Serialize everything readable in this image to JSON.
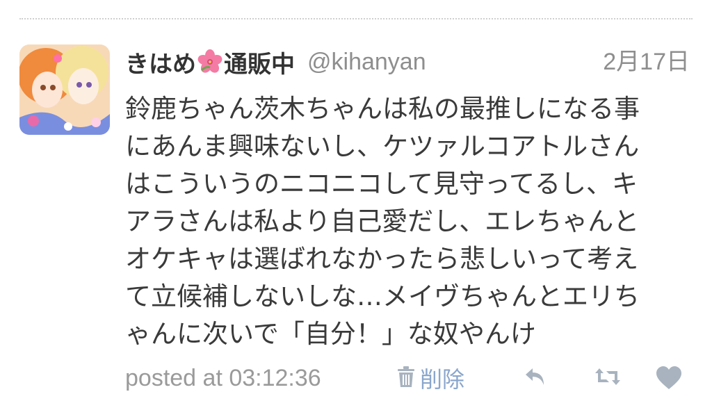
{
  "tweet": {
    "display_name_pre": "きはめ",
    "display_name_post": "通販中",
    "handle": "@kihanyan",
    "date": "2月17日",
    "body_lines": [
      "鈴鹿ちゃん茨木ちゃんは私の最推しになる事",
      "にあんま興味ないし、ケツァルコアトルさん",
      "はこういうのニコニコして見守ってるし、キ",
      "アラさんは私より自己愛だし、エレちゃんと",
      "オケキャは選ばれなかったら悲しいって考え",
      "て立候補しないしな…メイヴちゃんとエリち",
      "ゃんに次いで「自分！」な奴やんけ"
    ],
    "posted_at": "posted at 03:12:36",
    "delete_label": "削除"
  },
  "icons": {
    "avatar": "avatar-illustration",
    "flower": "hibiscus-emoji",
    "trash": "trash-icon",
    "reply": "reply-icon",
    "retweet": "retweet-icon",
    "favorite": "heart-icon"
  },
  "colors": {
    "text": "#3a3a3a",
    "muted": "#8e8e8e",
    "link": "#8aa6cc",
    "icon": "#a8b3bf"
  }
}
